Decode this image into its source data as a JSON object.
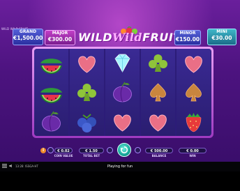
{
  "game": {
    "small_title": "WILD WILD FRUIT",
    "logo": {
      "part1": "WILD",
      "part2": "Wild",
      "part3": "FRUIT"
    }
  },
  "jackpots": {
    "grand": {
      "label": "GRAND",
      "value": "€1,500.00"
    },
    "major": {
      "label": "MAJOR",
      "value": "€300.00"
    },
    "minor": {
      "label": "MINOR",
      "value": "€150.00"
    },
    "mini": {
      "label": "MINI",
      "value": "€30.00"
    }
  },
  "reels": [
    [
      "watermelon",
      "watermelon",
      "plum"
    ],
    [
      "heart",
      "club",
      "blueberries"
    ],
    [
      "diamond",
      "plum",
      "heart"
    ],
    [
      "club",
      "spade",
      "heart"
    ],
    [
      "heart",
      "spade",
      "strawberry"
    ]
  ],
  "controls": {
    "coin_value": {
      "value": "€ 0.02",
      "label": "COIN VALUE"
    },
    "total_bet": {
      "value": "€ 1.50",
      "label": "TOTAL BET"
    },
    "balance": {
      "value": "€ 500.00",
      "label": "BALANCE"
    },
    "win": {
      "value": "€ 0.00",
      "label": "WIN"
    }
  },
  "footer": {
    "time": "13:28",
    "brand": "ISSGA·HT",
    "playing_text": "Playing for fun"
  },
  "colors": {
    "bg_top": "#6a1f9c",
    "reel_bg": "#2c1c78",
    "spin": "#18a79a"
  }
}
